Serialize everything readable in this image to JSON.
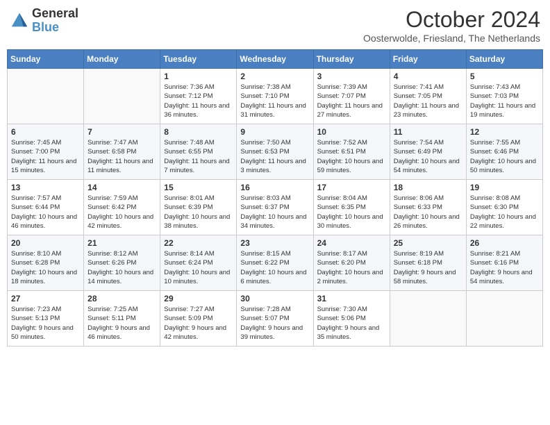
{
  "logo": {
    "text_general": "General",
    "text_blue": "Blue"
  },
  "title": "October 2024",
  "subtitle": "Oosterwolde, Friesland, The Netherlands",
  "days_of_week": [
    "Sunday",
    "Monday",
    "Tuesday",
    "Wednesday",
    "Thursday",
    "Friday",
    "Saturday"
  ],
  "weeks": [
    [
      {
        "day": "",
        "info": ""
      },
      {
        "day": "",
        "info": ""
      },
      {
        "day": "1",
        "info": "Sunrise: 7:36 AM\nSunset: 7:12 PM\nDaylight: 11 hours and 36 minutes."
      },
      {
        "day": "2",
        "info": "Sunrise: 7:38 AM\nSunset: 7:10 PM\nDaylight: 11 hours and 31 minutes."
      },
      {
        "day": "3",
        "info": "Sunrise: 7:39 AM\nSunset: 7:07 PM\nDaylight: 11 hours and 27 minutes."
      },
      {
        "day": "4",
        "info": "Sunrise: 7:41 AM\nSunset: 7:05 PM\nDaylight: 11 hours and 23 minutes."
      },
      {
        "day": "5",
        "info": "Sunrise: 7:43 AM\nSunset: 7:03 PM\nDaylight: 11 hours and 19 minutes."
      }
    ],
    [
      {
        "day": "6",
        "info": "Sunrise: 7:45 AM\nSunset: 7:00 PM\nDaylight: 11 hours and 15 minutes."
      },
      {
        "day": "7",
        "info": "Sunrise: 7:47 AM\nSunset: 6:58 PM\nDaylight: 11 hours and 11 minutes."
      },
      {
        "day": "8",
        "info": "Sunrise: 7:48 AM\nSunset: 6:55 PM\nDaylight: 11 hours and 7 minutes."
      },
      {
        "day": "9",
        "info": "Sunrise: 7:50 AM\nSunset: 6:53 PM\nDaylight: 11 hours and 3 minutes."
      },
      {
        "day": "10",
        "info": "Sunrise: 7:52 AM\nSunset: 6:51 PM\nDaylight: 10 hours and 59 minutes."
      },
      {
        "day": "11",
        "info": "Sunrise: 7:54 AM\nSunset: 6:49 PM\nDaylight: 10 hours and 54 minutes."
      },
      {
        "day": "12",
        "info": "Sunrise: 7:55 AM\nSunset: 6:46 PM\nDaylight: 10 hours and 50 minutes."
      }
    ],
    [
      {
        "day": "13",
        "info": "Sunrise: 7:57 AM\nSunset: 6:44 PM\nDaylight: 10 hours and 46 minutes."
      },
      {
        "day": "14",
        "info": "Sunrise: 7:59 AM\nSunset: 6:42 PM\nDaylight: 10 hours and 42 minutes."
      },
      {
        "day": "15",
        "info": "Sunrise: 8:01 AM\nSunset: 6:39 PM\nDaylight: 10 hours and 38 minutes."
      },
      {
        "day": "16",
        "info": "Sunrise: 8:03 AM\nSunset: 6:37 PM\nDaylight: 10 hours and 34 minutes."
      },
      {
        "day": "17",
        "info": "Sunrise: 8:04 AM\nSunset: 6:35 PM\nDaylight: 10 hours and 30 minutes."
      },
      {
        "day": "18",
        "info": "Sunrise: 8:06 AM\nSunset: 6:33 PM\nDaylight: 10 hours and 26 minutes."
      },
      {
        "day": "19",
        "info": "Sunrise: 8:08 AM\nSunset: 6:30 PM\nDaylight: 10 hours and 22 minutes."
      }
    ],
    [
      {
        "day": "20",
        "info": "Sunrise: 8:10 AM\nSunset: 6:28 PM\nDaylight: 10 hours and 18 minutes."
      },
      {
        "day": "21",
        "info": "Sunrise: 8:12 AM\nSunset: 6:26 PM\nDaylight: 10 hours and 14 minutes."
      },
      {
        "day": "22",
        "info": "Sunrise: 8:14 AM\nSunset: 6:24 PM\nDaylight: 10 hours and 10 minutes."
      },
      {
        "day": "23",
        "info": "Sunrise: 8:15 AM\nSunset: 6:22 PM\nDaylight: 10 hours and 6 minutes."
      },
      {
        "day": "24",
        "info": "Sunrise: 8:17 AM\nSunset: 6:20 PM\nDaylight: 10 hours and 2 minutes."
      },
      {
        "day": "25",
        "info": "Sunrise: 8:19 AM\nSunset: 6:18 PM\nDaylight: 9 hours and 58 minutes."
      },
      {
        "day": "26",
        "info": "Sunrise: 8:21 AM\nSunset: 6:16 PM\nDaylight: 9 hours and 54 minutes."
      }
    ],
    [
      {
        "day": "27",
        "info": "Sunrise: 7:23 AM\nSunset: 5:13 PM\nDaylight: 9 hours and 50 minutes."
      },
      {
        "day": "28",
        "info": "Sunrise: 7:25 AM\nSunset: 5:11 PM\nDaylight: 9 hours and 46 minutes."
      },
      {
        "day": "29",
        "info": "Sunrise: 7:27 AM\nSunset: 5:09 PM\nDaylight: 9 hours and 42 minutes."
      },
      {
        "day": "30",
        "info": "Sunrise: 7:28 AM\nSunset: 5:07 PM\nDaylight: 9 hours and 39 minutes."
      },
      {
        "day": "31",
        "info": "Sunrise: 7:30 AM\nSunset: 5:06 PM\nDaylight: 9 hours and 35 minutes."
      },
      {
        "day": "",
        "info": ""
      },
      {
        "day": "",
        "info": ""
      }
    ]
  ]
}
